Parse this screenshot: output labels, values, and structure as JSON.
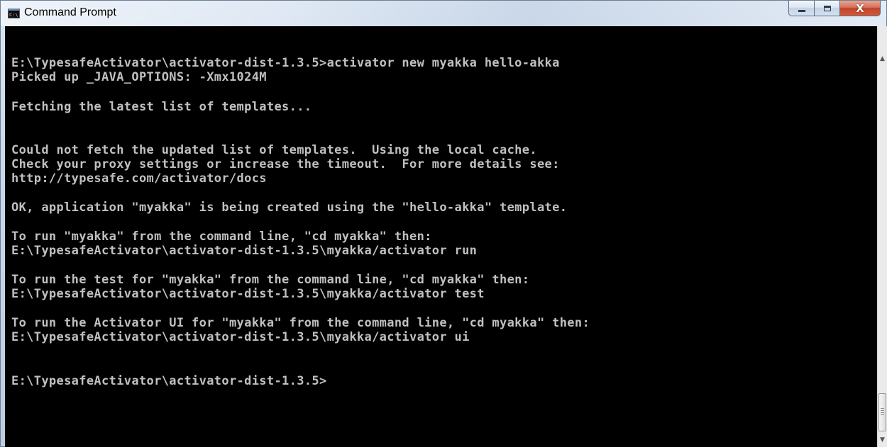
{
  "window": {
    "title": "Command Prompt",
    "icon": "console-app-icon",
    "icon_text": "C:\\",
    "controls": {
      "minimize": "minimize-icon",
      "maximize": "maximize-icon",
      "close": "close-icon",
      "close_glyph": "X"
    }
  },
  "console": {
    "lines": [
      "E:\\TypesafeActivator\\activator-dist-1.3.5>activator new myakka hello-akka",
      "Picked up _JAVA_OPTIONS: -Xmx1024M",
      "Fetching the latest list of templates...",
      "Could not fetch the updated list of templates.  Using the local cache.",
      "Check your proxy settings or increase the timeout.  For more details see:",
      "http://typesafe.com/activator/docs",
      "OK, application \"myakka\" is being created using the \"hello-akka\" template.",
      "To run \"myakka\" from the command line, \"cd myakka\" then:",
      "E:\\TypesafeActivator\\activator-dist-1.3.5\\myakka/activator run",
      "To run the test for \"myakka\" from the command line, \"cd myakka\" then:",
      "E:\\TypesafeActivator\\activator-dist-1.3.5\\myakka/activator test",
      "To run the Activator UI for \"myakka\" from the command line, \"cd myakka\" then:",
      "E:\\TypesafeActivator\\activator-dist-1.3.5\\myakka/activator ui",
      "E:\\TypesafeActivator\\activator-dist-1.3.5>"
    ]
  },
  "scrollbar": {
    "up_arrow": "▲",
    "down_arrow": "▼"
  },
  "colors": {
    "console_background": "#000000",
    "console_text": "#c0c0c0",
    "close_button": "#c8492f"
  }
}
